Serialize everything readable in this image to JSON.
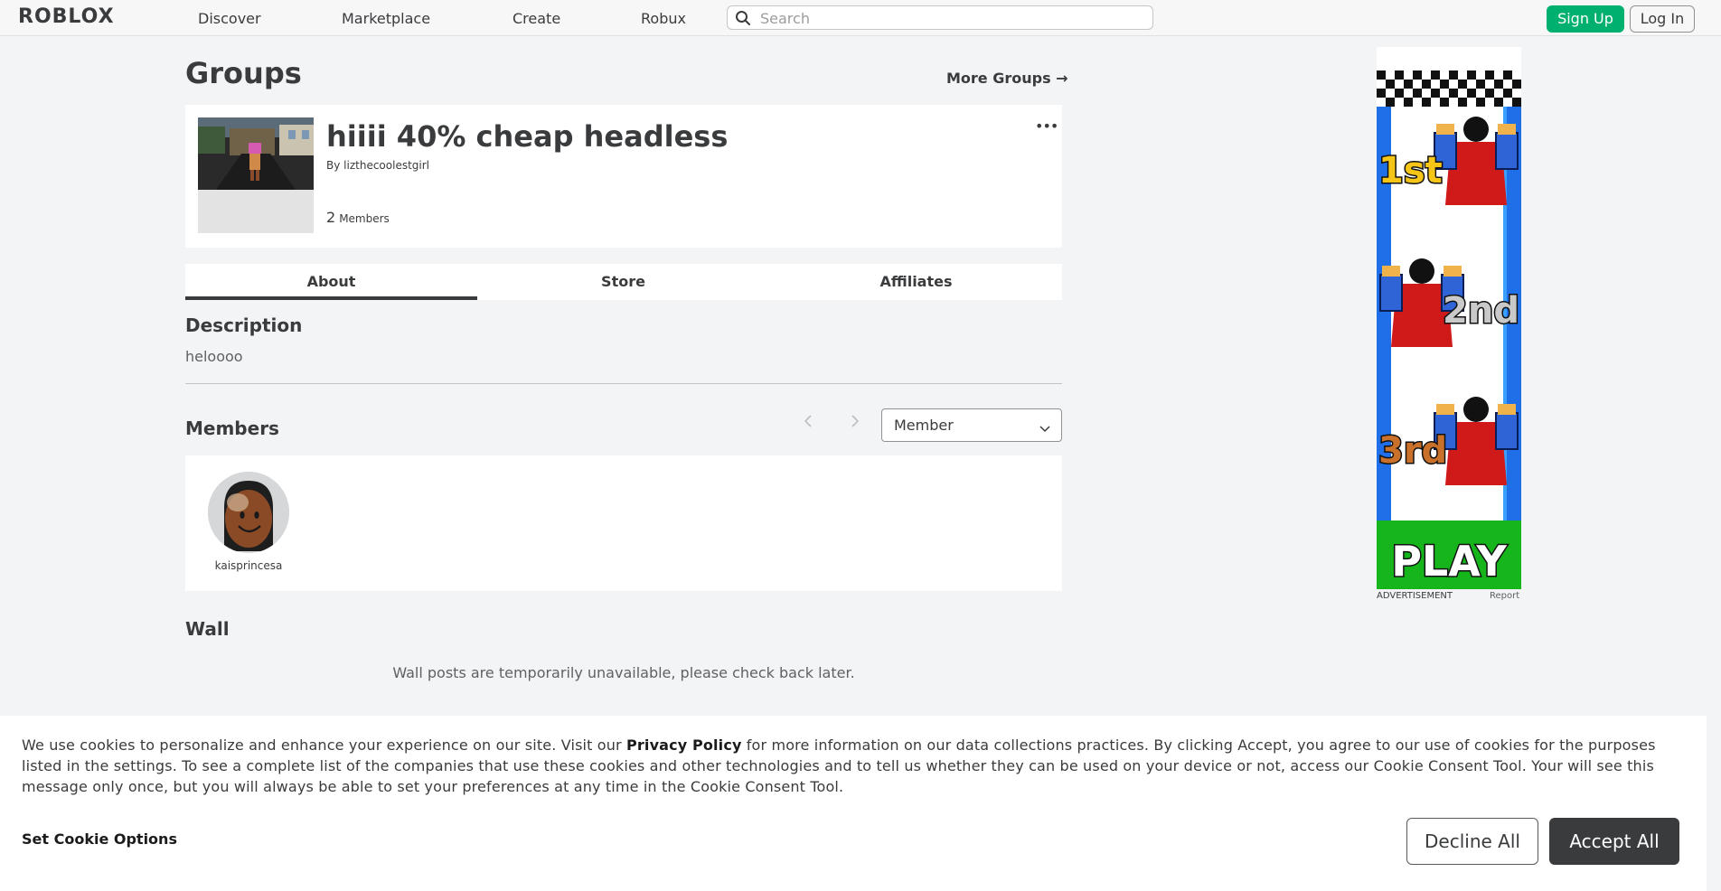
{
  "nav": {
    "logo": "ROBLOX",
    "links": [
      "Discover",
      "Marketplace",
      "Create",
      "Robux"
    ],
    "search_placeholder": "Search",
    "signup": "Sign Up",
    "login": "Log In"
  },
  "page": {
    "heading": "Groups",
    "more_groups": "More Groups →"
  },
  "group": {
    "name": "hiiii 40% cheap headless",
    "by_prefix": "By",
    "owner": "lizthecoolestgirl",
    "member_count": "2",
    "member_label": "Members",
    "more_options": "•••"
  },
  "tabs": [
    "About",
    "Store",
    "Affiliates"
  ],
  "active_tab": "About",
  "description": {
    "heading": "Description",
    "text": "heloooo"
  },
  "members": {
    "heading": "Members",
    "role_selected": "Member",
    "list": [
      {
        "username": "kaisprincesa"
      }
    ]
  },
  "wall": {
    "heading": "Wall",
    "message": "Wall posts are temporarily unavailable, please check back later."
  },
  "ad": {
    "label": "ADVERTISEMENT",
    "report": "Report",
    "places": [
      "1st",
      "2nd",
      "3rd"
    ],
    "cta": "PLAY"
  },
  "cookie": {
    "text_before": "We use cookies to personalize and enhance your experience on our site. Visit our ",
    "link": "Privacy Policy",
    "text_after": " for more information on our data collections practices. By clicking Accept, you agree to our use of cookies for the purposes listed in the settings. To see a complete list of the companies that use these cookies and other technologies and to tell us whether they can be used on your device or not, access our Cookie Consent Tool. Your will see this message only once, but you will always be able to set your preferences at any time in the Cookie Consent Tool.",
    "set_options": "Set Cookie Options",
    "decline": "Decline All",
    "accept": "Accept All"
  },
  "colors": {
    "accent_green": "#00b06f",
    "text_dark": "#393b3d",
    "page_bg": "#f2f4f5"
  }
}
